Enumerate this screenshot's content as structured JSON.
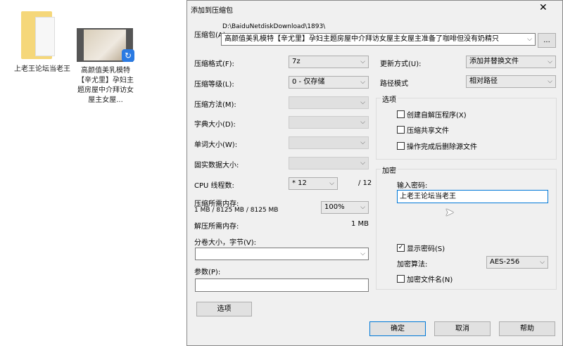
{
  "desktop": {
    "items": [
      {
        "label": "上老王论坛当老王",
        "icon": "folder-icon"
      },
      {
        "label": "高颜值美乳模特【辛尤里】孕妇主题房屋中介拜访女屋主女屋...",
        "icon": "video-file-icon"
      }
    ]
  },
  "dialog": {
    "title": "添加到压缩包",
    "archive_label": "压缩包(A)",
    "archive_path": "D:\\BaiduNetdiskDownload\\1893\\",
    "archive_name": "高颜值美乳模特【辛尤里】孕妇主题房屋中介拜访女屋主女屋主准备了咖啡但没有奶精只",
    "browse": "...",
    "format_label": "压缩格式(F):",
    "format": "7z",
    "level_label": "压缩等级(L):",
    "level": "0 - 仅存储",
    "method_label": "压缩方法(M):",
    "dict_label": "字典大小(D):",
    "word_label": "单词大小(W):",
    "solid_label": "固实数据大小:",
    "cpu_label": "CPU 线程数:",
    "cpu": "* 12",
    "cpu_max": "/ 12",
    "mem_label": "压缩所需内存:",
    "mem_value": "1 MB / 8125 MB / 8125 MB",
    "mem_percent": "100%",
    "dmem_label": "解压所需内存:",
    "dmem_value": "1 MB",
    "volume_label": "分卷大小，字节(V):",
    "volume": "",
    "params_label": "参数(P):",
    "params": "",
    "options_button": "选项",
    "update_label": "更新方式(U):",
    "update": "添加并替换文件",
    "path_label": "路径模式",
    "path_mode": "相对路径",
    "options_group": "选项",
    "opt_sfx": "创建自解压程序(X)",
    "opt_shared": "压缩共享文件",
    "opt_delete": "操作完成后删除源文件",
    "enc_group": "加密",
    "pwd_label": "输入密码:",
    "password": "上老王论坛当老王",
    "show_pwd": "显示密码(S)",
    "show_pwd_checked": true,
    "alg_label": "加密算法:",
    "alg": "AES-256",
    "enc_names": "加密文件名(N)",
    "ok": "确定",
    "cancel": "取消",
    "help": "帮助",
    "accent": "#0078d7"
  }
}
